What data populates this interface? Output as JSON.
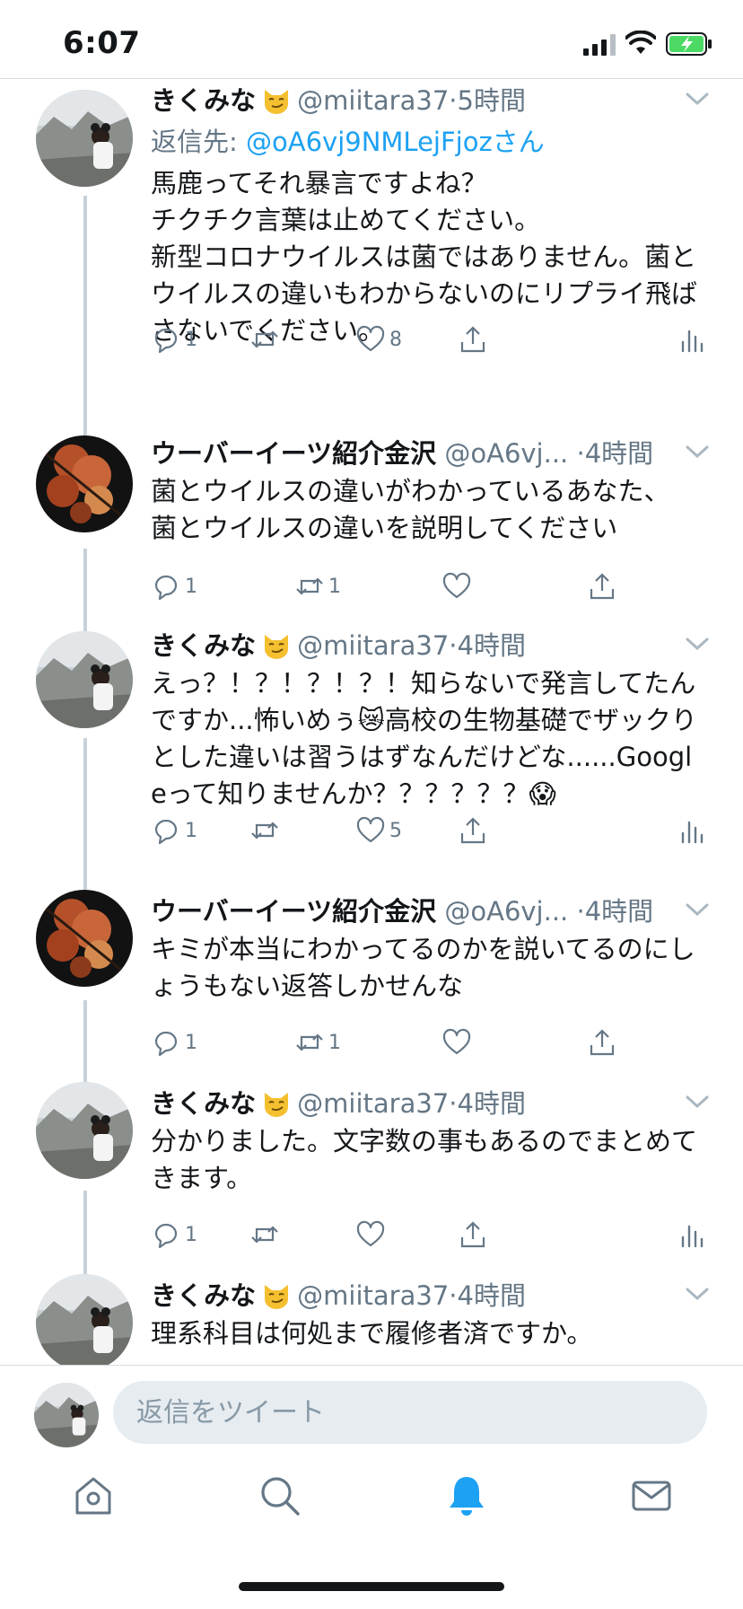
{
  "status_bar": {
    "time": "6:07"
  },
  "thread": {
    "tweets": [
      {
        "name": "きくみな",
        "emoji": "smirking-cat-emoji",
        "handle": "@miitara37",
        "time": "5時間",
        "reply_label": "返信先: ",
        "reply_mention": "@oA6vj9NMLejFjozさん",
        "text": "馬鹿ってそれ暴言ですよね？\nチクチク言葉は止めてください。\n新型コロナウイルスは菌ではありません。菌とウイルスの違いもわからないのにリプライ飛ばさないでください。",
        "reply_count": "1",
        "retweet_count": "",
        "like_count": "8"
      },
      {
        "name": "ウーバーイーツ紹介金沢",
        "handle": "@oA6vj...",
        "time": "4時間",
        "text": "菌とウイルスの違いがわかっているあなた、\n菌とウイルスの違いを説明してください",
        "reply_count": "1",
        "retweet_count": "1",
        "like_count": ""
      },
      {
        "name": "きくみな",
        "emoji": "smirking-cat-emoji",
        "handle": "@miitara37",
        "time": "4時間",
        "text": "えっ？！？！？！？！知らないで発言してたんですか...怖いめぅ😿高校の生物基礎でザックりとした違いは習うはずなんだけどな......Googleって知りませんか？？？？？？😱",
        "reply_count": "1",
        "retweet_count": "",
        "like_count": "5"
      },
      {
        "name": "ウーバーイーツ紹介金沢",
        "handle": "@oA6vj...",
        "time": "4時間",
        "text": "キミが本当にわかってるのかを説いてるのにしょうもない返答しかせんな",
        "reply_count": "1",
        "retweet_count": "1",
        "like_count": ""
      },
      {
        "name": "きくみな",
        "emoji": "smirking-cat-emoji",
        "handle": "@miitara37",
        "time": "4時間",
        "text": "分かりました。文字数の事もあるのでまとめてきます。",
        "reply_count": "1",
        "retweet_count": "",
        "like_count": ""
      },
      {
        "name": "きくみな",
        "emoji": "smirking-cat-emoji",
        "handle": "@miitara37",
        "time": "4時間",
        "text": "理系科目は何処まで履修者済ですか。",
        "reply_count": "",
        "retweet_count": "",
        "like_count": ""
      }
    ]
  },
  "reply_bar": {
    "placeholder": "返信をツイート"
  },
  "tab_bar": {
    "icons": [
      "home-icon",
      "search-icon",
      "notifications-icon",
      "messages-icon"
    ],
    "active": "notifications-icon",
    "active_color": "#1da1f2"
  },
  "colors": {
    "link": "#1da1f2",
    "secondary": "#657786",
    "thread_line": "#c7d1d9"
  }
}
